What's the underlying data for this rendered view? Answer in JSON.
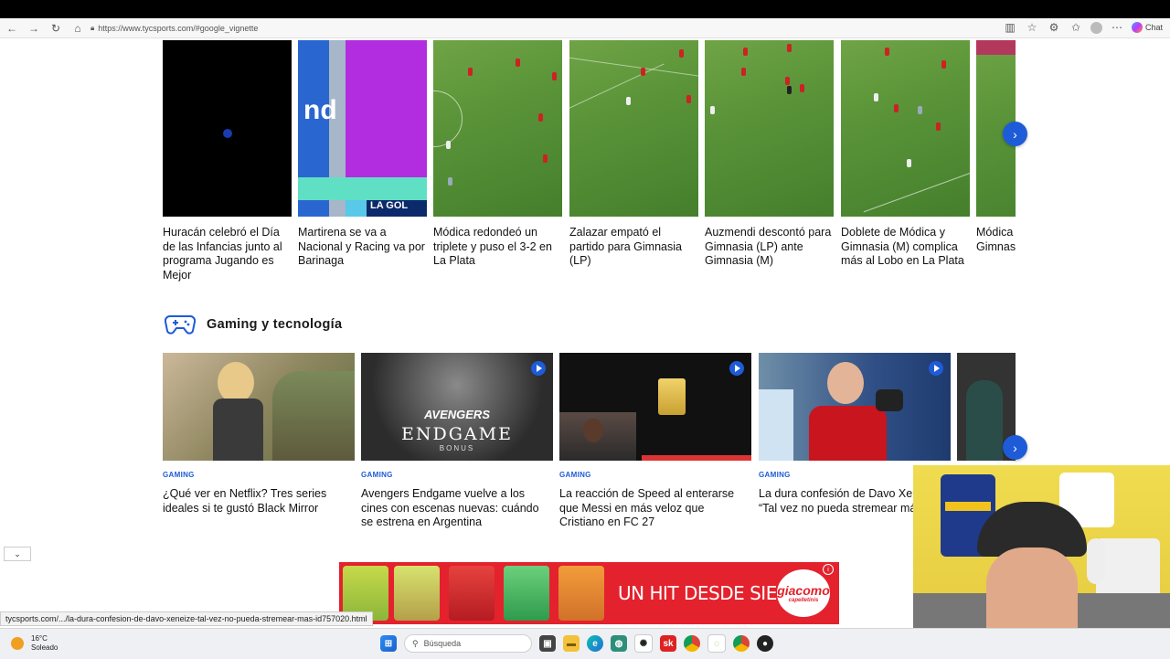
{
  "browser": {
    "url": "https://www.tycsports.com/#google_vignette",
    "chat_label": "Chat"
  },
  "video_carousel": {
    "items": [
      {
        "title": "Huracán celebró el Día de las Infancias junto al programa Jugando es Mejor"
      },
      {
        "title": "Martirena se va a Nacional y Racing va por Barinaga"
      },
      {
        "title": "Módica redondeó un triplete y puso el 3-2 en La Plata"
      },
      {
        "title": "Zalazar empató el partido para Gimnasia (LP)"
      },
      {
        "title": "Auzmendi descontó para Gimnasia (LP) ante Gimnasia (M)"
      },
      {
        "title": "Doblete de Módica y Gimnasia (M) complica más al Lobo en La Plata"
      },
      {
        "title": "Módica Gimnas marcad Gimnas"
      }
    ],
    "thumb_overlay_text": "LA GOL"
  },
  "gaming_section": {
    "title": "Gaming y tecnología",
    "items": [
      {
        "category": "GAMING",
        "title": "¿Qué ver en Netflix? Tres series ideales si te gustó Black Mirror",
        "has_video": false
      },
      {
        "category": "GAMING",
        "title": "Avengers Endgame vuelve a los cines con escenas nuevas: cuándo se estrena en Argentina",
        "has_video": true,
        "thumb_text_1": "AVENGERS",
        "thumb_text_2": "ENDGAME",
        "thumb_text_3": "BONUS"
      },
      {
        "category": "GAMING",
        "title": "La reacción de Speed al enterarse que Messi en más veloz que Cristiano en FC 27",
        "has_video": true
      },
      {
        "category": "GAMING",
        "title": "La dura confesión de Davo Xeneize: “Tal vez no pueda stremear más”",
        "has_video": true
      }
    ]
  },
  "ad": {
    "slogan": "UN HIT DESDE SIEMPRE",
    "brand": "giacomo",
    "brand_sub": "capelletinis"
  },
  "status_url": "tycsports.com/.../la-dura-confesion-de-davo-xeneize-tal-vez-no-pueda-stremear-mas-id757020.html",
  "taskbar": {
    "temperature": "16°C",
    "condition": "Soleado",
    "search_placeholder": "Búsqueda"
  },
  "colors": {
    "accent": "#1e5bd8",
    "ad_red": "#e3222d"
  }
}
